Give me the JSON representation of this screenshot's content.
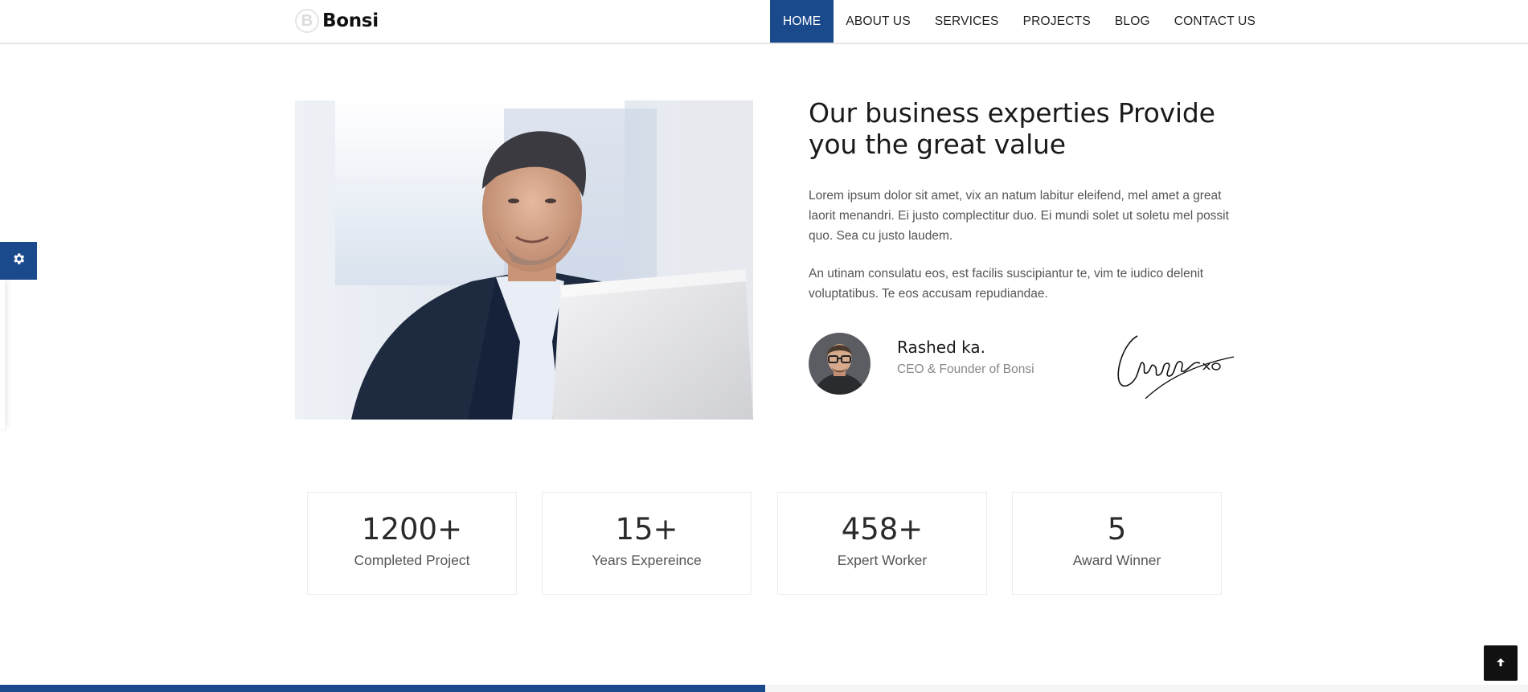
{
  "header": {
    "logo_mark": "B",
    "logo_text": "Bonsi",
    "nav": [
      "HOME",
      "ABOUT US",
      "SERVICES",
      "PROJECTS",
      "BLOG",
      "CONTACT US"
    ],
    "active_nav": "HOME"
  },
  "sidebar": {
    "settings_icon": "gear-icon"
  },
  "about": {
    "headline": "Our business experties Provide you the great value",
    "paragraph1": "Lorem ipsum dolor sit amet, vix an natum labitur eleifend, mel amet a great laorit menandri. Ei justo complectitur duo. Ei mundi solet ut soletu mel possit quo. Sea cu justo laudem.",
    "paragraph2": "An utinam consulatu eos, est facilis suscipiantur te, vim te iudico delenit voluptatibus. Te eos accusam repudiandae.",
    "ceo_name": "Rashed ka.",
    "ceo_title": "CEO & Founder of Bonsi",
    "signature_text": "Cenbyn xo"
  },
  "stats": [
    {
      "value": "1200+",
      "label": "Completed Project"
    },
    {
      "value": "15+",
      "label": "Years Expereince"
    },
    {
      "value": "458+",
      "label": "Expert Worker"
    },
    {
      "value": "5",
      "label": "Award Winner"
    }
  ],
  "colors": {
    "primary": "#1b4a8c",
    "text": "#222222",
    "muted": "#555555"
  },
  "scroll_top_icon": "arrow-up-icon"
}
